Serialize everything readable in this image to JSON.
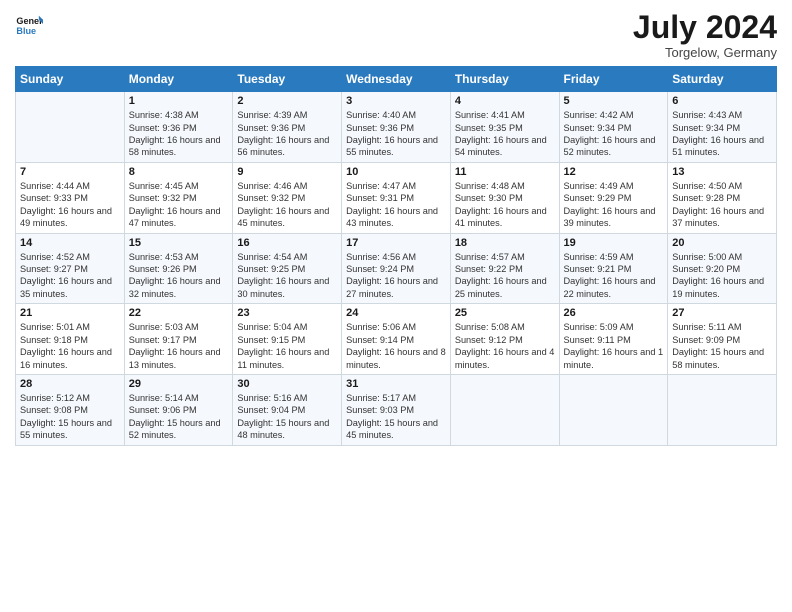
{
  "logo": {
    "line1": "General",
    "line2": "Blue"
  },
  "title": "July 2024",
  "location": "Torgelow, Germany",
  "headers": [
    "Sunday",
    "Monday",
    "Tuesday",
    "Wednesday",
    "Thursday",
    "Friday",
    "Saturday"
  ],
  "weeks": [
    [
      {
        "day": "",
        "info": ""
      },
      {
        "day": "1",
        "info": "Sunrise: 4:38 AM\nSunset: 9:36 PM\nDaylight: 16 hours\nand 58 minutes."
      },
      {
        "day": "2",
        "info": "Sunrise: 4:39 AM\nSunset: 9:36 PM\nDaylight: 16 hours\nand 56 minutes."
      },
      {
        "day": "3",
        "info": "Sunrise: 4:40 AM\nSunset: 9:36 PM\nDaylight: 16 hours\nand 55 minutes."
      },
      {
        "day": "4",
        "info": "Sunrise: 4:41 AM\nSunset: 9:35 PM\nDaylight: 16 hours\nand 54 minutes."
      },
      {
        "day": "5",
        "info": "Sunrise: 4:42 AM\nSunset: 9:34 PM\nDaylight: 16 hours\nand 52 minutes."
      },
      {
        "day": "6",
        "info": "Sunrise: 4:43 AM\nSunset: 9:34 PM\nDaylight: 16 hours\nand 51 minutes."
      }
    ],
    [
      {
        "day": "7",
        "info": "Sunrise: 4:44 AM\nSunset: 9:33 PM\nDaylight: 16 hours\nand 49 minutes."
      },
      {
        "day": "8",
        "info": "Sunrise: 4:45 AM\nSunset: 9:32 PM\nDaylight: 16 hours\nand 47 minutes."
      },
      {
        "day": "9",
        "info": "Sunrise: 4:46 AM\nSunset: 9:32 PM\nDaylight: 16 hours\nand 45 minutes."
      },
      {
        "day": "10",
        "info": "Sunrise: 4:47 AM\nSunset: 9:31 PM\nDaylight: 16 hours\nand 43 minutes."
      },
      {
        "day": "11",
        "info": "Sunrise: 4:48 AM\nSunset: 9:30 PM\nDaylight: 16 hours\nand 41 minutes."
      },
      {
        "day": "12",
        "info": "Sunrise: 4:49 AM\nSunset: 9:29 PM\nDaylight: 16 hours\nand 39 minutes."
      },
      {
        "day": "13",
        "info": "Sunrise: 4:50 AM\nSunset: 9:28 PM\nDaylight: 16 hours\nand 37 minutes."
      }
    ],
    [
      {
        "day": "14",
        "info": "Sunrise: 4:52 AM\nSunset: 9:27 PM\nDaylight: 16 hours\nand 35 minutes."
      },
      {
        "day": "15",
        "info": "Sunrise: 4:53 AM\nSunset: 9:26 PM\nDaylight: 16 hours\nand 32 minutes."
      },
      {
        "day": "16",
        "info": "Sunrise: 4:54 AM\nSunset: 9:25 PM\nDaylight: 16 hours\nand 30 minutes."
      },
      {
        "day": "17",
        "info": "Sunrise: 4:56 AM\nSunset: 9:24 PM\nDaylight: 16 hours\nand 27 minutes."
      },
      {
        "day": "18",
        "info": "Sunrise: 4:57 AM\nSunset: 9:22 PM\nDaylight: 16 hours\nand 25 minutes."
      },
      {
        "day": "19",
        "info": "Sunrise: 4:59 AM\nSunset: 9:21 PM\nDaylight: 16 hours\nand 22 minutes."
      },
      {
        "day": "20",
        "info": "Sunrise: 5:00 AM\nSunset: 9:20 PM\nDaylight: 16 hours\nand 19 minutes."
      }
    ],
    [
      {
        "day": "21",
        "info": "Sunrise: 5:01 AM\nSunset: 9:18 PM\nDaylight: 16 hours\nand 16 minutes."
      },
      {
        "day": "22",
        "info": "Sunrise: 5:03 AM\nSunset: 9:17 PM\nDaylight: 16 hours\nand 13 minutes."
      },
      {
        "day": "23",
        "info": "Sunrise: 5:04 AM\nSunset: 9:15 PM\nDaylight: 16 hours\nand 11 minutes."
      },
      {
        "day": "24",
        "info": "Sunrise: 5:06 AM\nSunset: 9:14 PM\nDaylight: 16 hours\nand 8 minutes."
      },
      {
        "day": "25",
        "info": "Sunrise: 5:08 AM\nSunset: 9:12 PM\nDaylight: 16 hours\nand 4 minutes."
      },
      {
        "day": "26",
        "info": "Sunrise: 5:09 AM\nSunset: 9:11 PM\nDaylight: 16 hours\nand 1 minute."
      },
      {
        "day": "27",
        "info": "Sunrise: 5:11 AM\nSunset: 9:09 PM\nDaylight: 15 hours\nand 58 minutes."
      }
    ],
    [
      {
        "day": "28",
        "info": "Sunrise: 5:12 AM\nSunset: 9:08 PM\nDaylight: 15 hours\nand 55 minutes."
      },
      {
        "day": "29",
        "info": "Sunrise: 5:14 AM\nSunset: 9:06 PM\nDaylight: 15 hours\nand 52 minutes."
      },
      {
        "day": "30",
        "info": "Sunrise: 5:16 AM\nSunset: 9:04 PM\nDaylight: 15 hours\nand 48 minutes."
      },
      {
        "day": "31",
        "info": "Sunrise: 5:17 AM\nSunset: 9:03 PM\nDaylight: 15 hours\nand 45 minutes."
      },
      {
        "day": "",
        "info": ""
      },
      {
        "day": "",
        "info": ""
      },
      {
        "day": "",
        "info": ""
      }
    ]
  ]
}
